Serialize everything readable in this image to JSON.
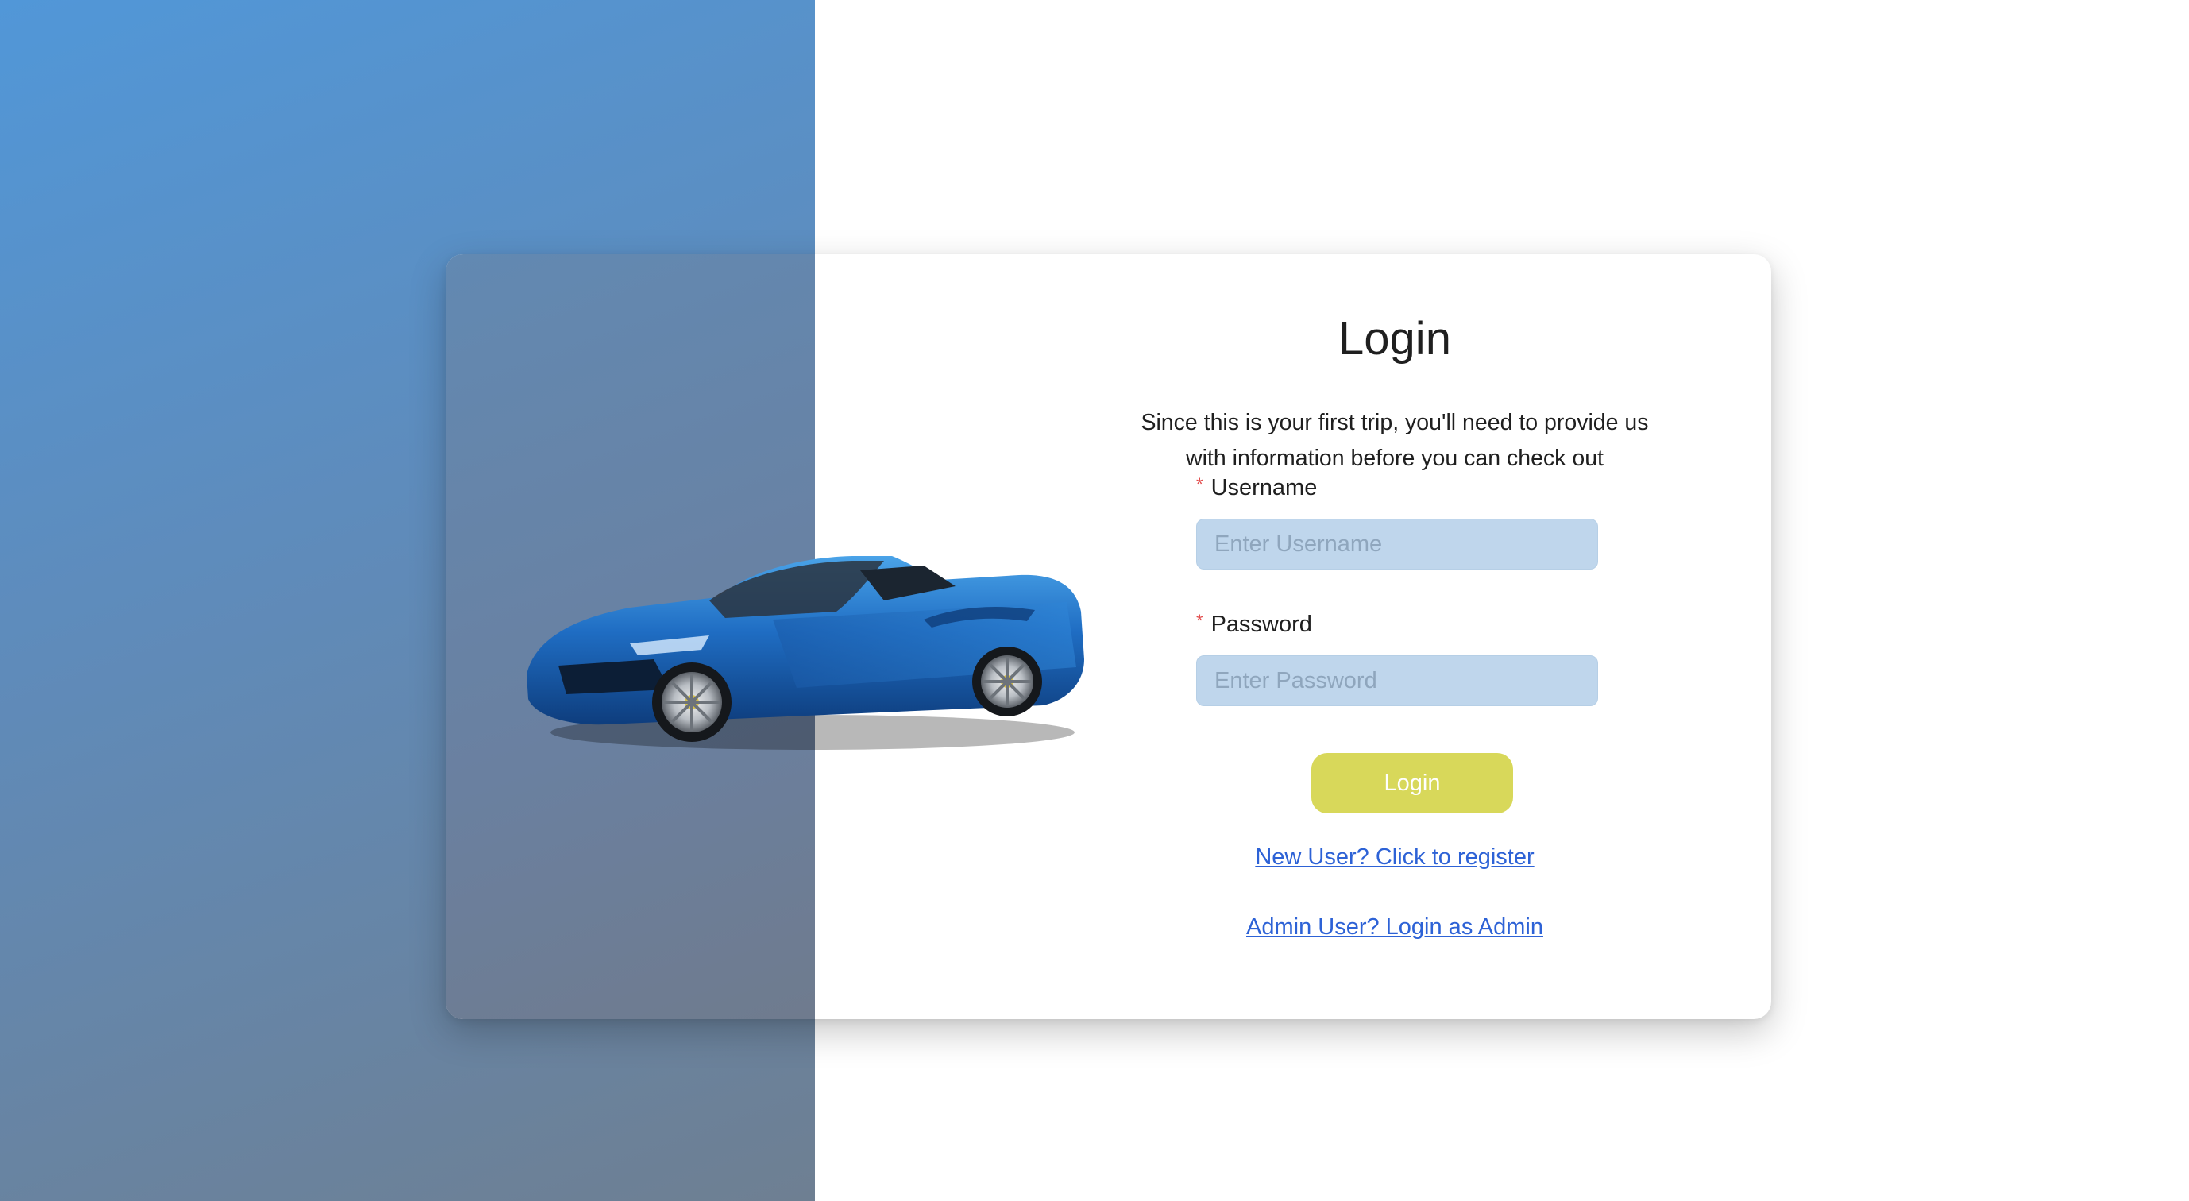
{
  "login": {
    "title": "Login",
    "subtitle_line1": "Since this is your first trip, you'll need to provide us",
    "subtitle_line2": "with information before you can check out",
    "required_mark": "*",
    "username_label": "Username",
    "username_placeholder": "Enter Username",
    "username_value": "",
    "password_label": "Password",
    "password_placeholder": "Enter Password",
    "password_value": "",
    "submit_label": "Login",
    "register_link": "New User? Click to register",
    "admin_link": "Admin User? Login as Admin"
  },
  "colors": {
    "button": "#d8d85a",
    "input_background": "#bfd6ec",
    "link": "#2d62d6",
    "required": "#e24b4b",
    "gradient_top": "#5197d8",
    "gradient_bottom": "#6e7f92"
  },
  "images": {
    "hero": "blue-convertible-sports-car"
  }
}
